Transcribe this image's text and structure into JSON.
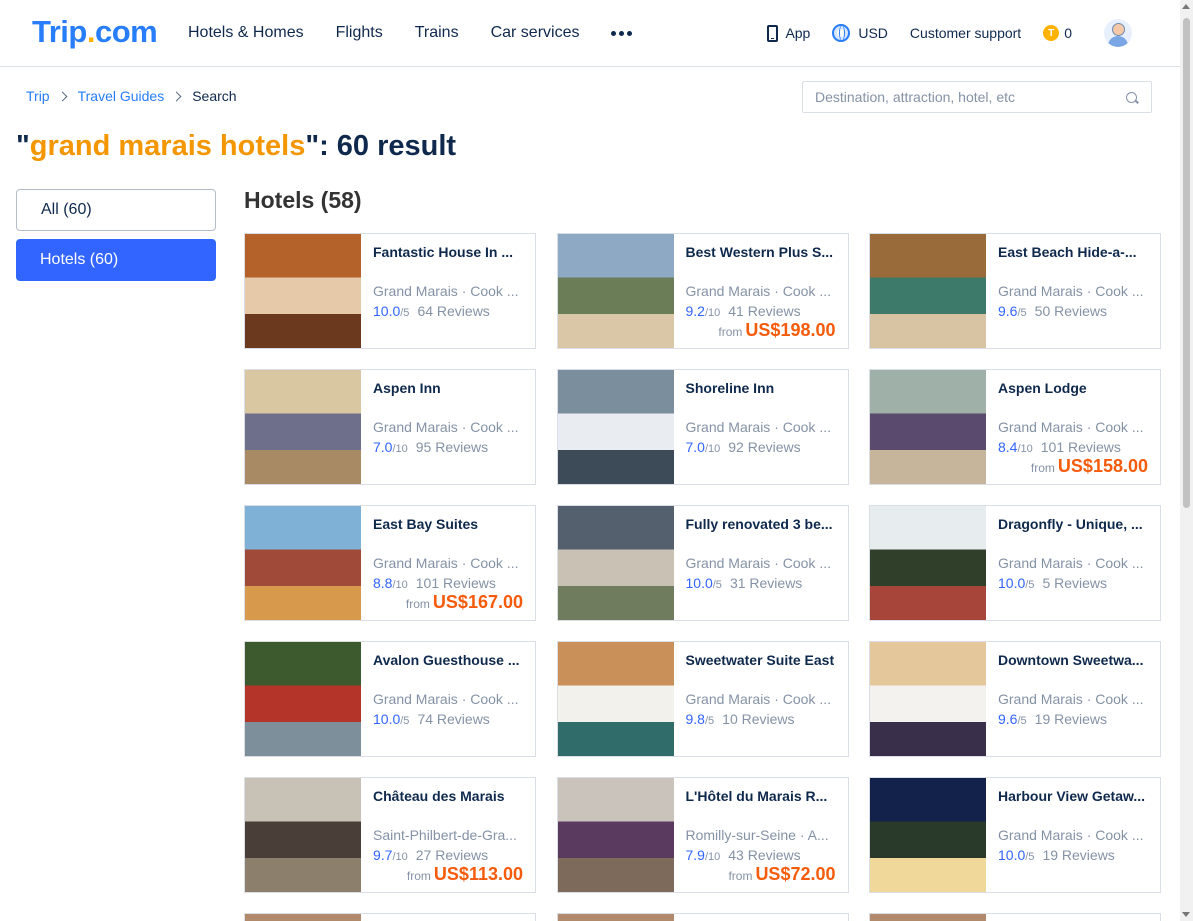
{
  "header": {
    "logo_main": "Trip",
    "logo_dot": ".",
    "logo_com": "com",
    "nav": [
      "Hotels & Homes",
      "Flights",
      "Trains",
      "Car services"
    ],
    "app_label": "App",
    "currency": "USD",
    "support": "Customer support",
    "coins": "0",
    "coin_symbol": "T"
  },
  "breadcrumb": {
    "items": [
      "Trip",
      "Travel Guides"
    ],
    "current": "Search"
  },
  "search": {
    "placeholder": "Destination, attraction, hotel, etc",
    "value": ""
  },
  "title": {
    "open_quote": "\"",
    "keyword": "grand marais hotels",
    "suffix": "\": 60 result"
  },
  "sidebar": {
    "all": "All (60)",
    "hotels": "Hotels (60)"
  },
  "section_title": "Hotels (58)",
  "hotels": [
    {
      "name": "Fantastic House In ...",
      "loc": "Grand Marais · Cook ...",
      "score": "10.0",
      "scale": "/5",
      "reviews": "64 Reviews",
      "from": "",
      "price": ""
    },
    {
      "name": "Best Western Plus S...",
      "loc": "Grand Marais · Cook ...",
      "score": "9.2",
      "scale": "/10",
      "reviews": "41 Reviews",
      "from": "from",
      "price": "US$198.00"
    },
    {
      "name": "East Beach Hide-a-...",
      "loc": "Grand Marais · Cook ...",
      "score": "9.6",
      "scale": "/5",
      "reviews": "50 Reviews",
      "from": "",
      "price": ""
    },
    {
      "name": "Aspen Inn",
      "loc": "Grand Marais · Cook ...",
      "score": "7.0",
      "scale": "/10",
      "reviews": "95 Reviews",
      "from": "",
      "price": ""
    },
    {
      "name": "Shoreline Inn",
      "loc": "Grand Marais · Cook ...",
      "score": "7.0",
      "scale": "/10",
      "reviews": "92 Reviews",
      "from": "",
      "price": ""
    },
    {
      "name": "Aspen Lodge",
      "loc": "Grand Marais · Cook ...",
      "score": "8.4",
      "scale": "/10",
      "reviews": "101 Reviews",
      "from": "from",
      "price": "US$158.00"
    },
    {
      "name": "East Bay Suites",
      "loc": "Grand Marais · Cook ...",
      "score": "8.8",
      "scale": "/10",
      "reviews": "101 Reviews",
      "from": "from",
      "price": "US$167.00"
    },
    {
      "name": "Fully renovated 3 be...",
      "loc": "Grand Marais · Cook ...",
      "score": "10.0",
      "scale": "/5",
      "reviews": "31 Reviews",
      "from": "",
      "price": ""
    },
    {
      "name": "Dragonfly - Unique, ...",
      "loc": "Grand Marais · Cook ...",
      "score": "10.0",
      "scale": "/5",
      "reviews": "5 Reviews",
      "from": "",
      "price": ""
    },
    {
      "name": "Avalon Guesthouse ...",
      "loc": "Grand Marais · Cook ...",
      "score": "10.0",
      "scale": "/5",
      "reviews": "74 Reviews",
      "from": "",
      "price": ""
    },
    {
      "name": "Sweetwater Suite East",
      "loc": "Grand Marais · Cook ...",
      "score": "9.8",
      "scale": "/5",
      "reviews": "10 Reviews",
      "from": "",
      "price": ""
    },
    {
      "name": "Downtown Sweetwa...",
      "loc": "Grand Marais · Cook ...",
      "score": "9.6",
      "scale": "/5",
      "reviews": "19 Reviews",
      "from": "",
      "price": ""
    },
    {
      "name": "Château des Marais",
      "loc": "Saint-Philbert-de-Gra...",
      "score": "9.7",
      "scale": "/10",
      "reviews": "27 Reviews",
      "from": "from",
      "price": "US$113.00"
    },
    {
      "name": "L'Hôtel du Marais R...",
      "loc": "Romilly-sur-Seine · A...",
      "score": "7.9",
      "scale": "/10",
      "reviews": "43 Reviews",
      "from": "from",
      "price": "US$72.00"
    },
    {
      "name": "Harbour View Getaw...",
      "loc": "Grand Marais · Cook ...",
      "score": "10.0",
      "scale": "/5",
      "reviews": "19 Reviews",
      "from": "",
      "price": ""
    }
  ],
  "thumb_palettes": [
    [
      "#b4622a",
      "#e6c9a8",
      "#6b3a1e"
    ],
    [
      "#8ea9c4",
      "#6a7d56",
      "#d9c7a8"
    ],
    [
      "#9a6b3a",
      "#3e7a6a",
      "#d8c3a2"
    ],
    [
      "#d8c7a0",
      "#6e6f8a",
      "#a88b64"
    ],
    [
      "#7a8e9e",
      "#e9edf1",
      "#3d4a57"
    ],
    [
      "#9eb0a8",
      "#5a4a6e",
      "#c6b59a"
    ],
    [
      "#7fb1d6",
      "#a04a3a",
      "#d79a4c"
    ],
    [
      "#55606e",
      "#c9c2b4",
      "#6f7c5d"
    ],
    [
      "#e7ecef",
      "#2f3f2a",
      "#a8453a"
    ],
    [
      "#3d5a2f",
      "#b5342a",
      "#7d8f9a"
    ],
    [
      "#c9905a",
      "#f3f1ec",
      "#2f6c6a"
    ],
    [
      "#e4c79a",
      "#f4f2ee",
      "#3a2f4a"
    ],
    [
      "#c8c2b6",
      "#4a3f38",
      "#8c7f6c"
    ],
    [
      "#c9c3bb",
      "#5a3a5e",
      "#7d6a5a"
    ],
    [
      "#13224a",
      "#2a3a2a",
      "#f0d89a"
    ]
  ]
}
